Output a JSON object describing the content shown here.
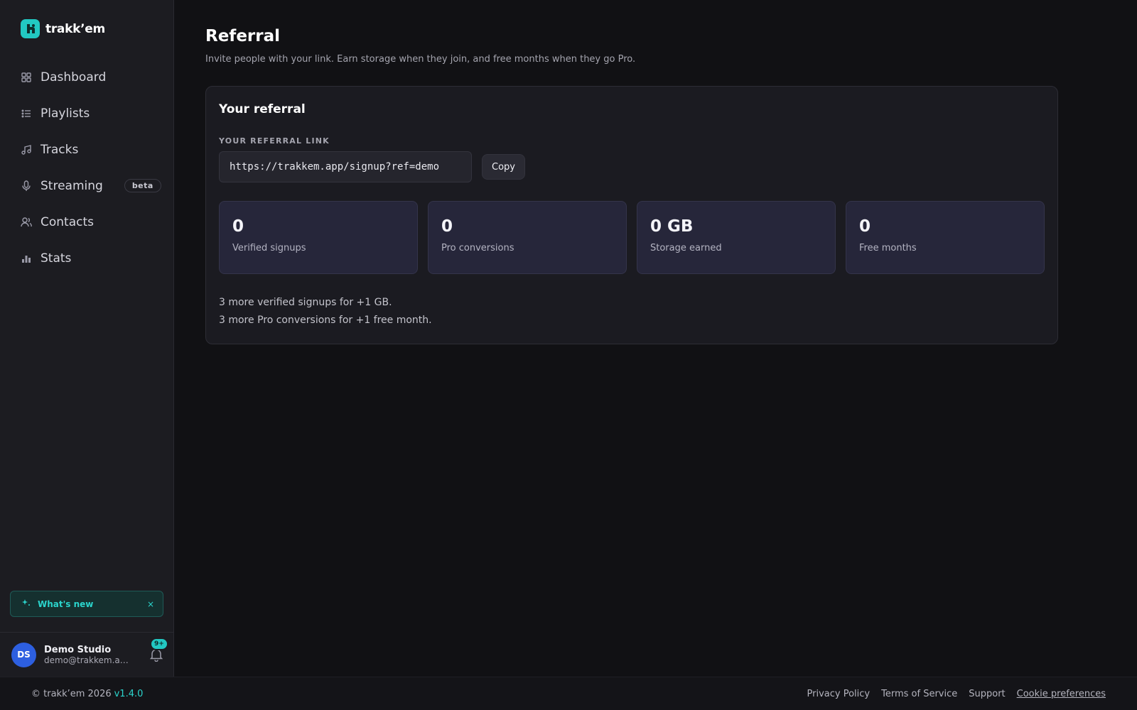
{
  "brand": {
    "name": "trakk’em",
    "accent": "#22c8c2"
  },
  "sidebar": {
    "items": [
      {
        "label": "Dashboard",
        "icon": "dashboard-grid-icon"
      },
      {
        "label": "Playlists",
        "icon": "list-icon"
      },
      {
        "label": "Tracks",
        "icon": "music-note-icon"
      },
      {
        "label": "Streaming",
        "icon": "microphone-icon",
        "badge": "beta"
      },
      {
        "label": "Contacts",
        "icon": "users-icon"
      },
      {
        "label": "Stats",
        "icon": "bar-chart-icon"
      }
    ],
    "whats_new": {
      "label": "What's new",
      "close": "×"
    },
    "user": {
      "initials": "DS",
      "name": "Demo Studio",
      "email": "demo@trakkem.app",
      "notifications": "9+"
    }
  },
  "main": {
    "title": "Referral",
    "subtitle": "Invite people with your link. Earn storage when they join, and free months when they go Pro.",
    "card": {
      "title": "Your referral",
      "link_label": "YOUR REFERRAL LINK",
      "link_value": "https://trakkem.app/signup?ref=demo",
      "copy_label": "Copy",
      "stats": [
        {
          "value": "0",
          "label": "Verified signups"
        },
        {
          "value": "0",
          "label": "Pro conversions"
        },
        {
          "value": "0 GB",
          "label": "Storage earned"
        },
        {
          "value": "0",
          "label": "Free months"
        }
      ],
      "notes": [
        "3 more verified signups for +1 GB.",
        "3 more Pro conversions for +1 free month."
      ]
    }
  },
  "footer": {
    "copyright": "© trakk’em 2026",
    "version": "v1.4.0",
    "links": [
      "Privacy Policy",
      "Terms of Service",
      "Support",
      "Cookie preferences"
    ]
  }
}
